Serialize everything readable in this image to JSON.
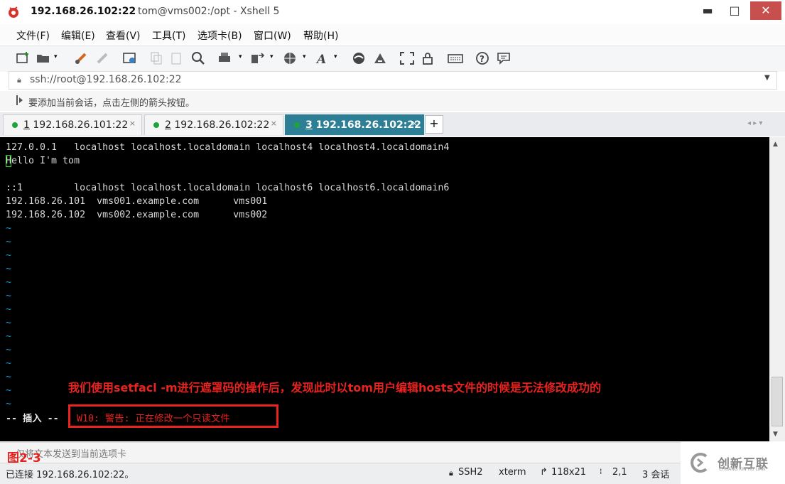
{
  "window": {
    "title_host": "192.168.26.102:22",
    "title_rest": "tom@vms002:/opt - Xshell 5",
    "minimize": "▬",
    "maximize": "□",
    "close": "✕"
  },
  "menu": [
    "文件(F)",
    "编辑(E)",
    "查看(V)",
    "工具(T)",
    "选项卡(B)",
    "窗口(W)",
    "帮助(H)"
  ],
  "toolbar_icons": [
    "new-session-icon",
    "open-folder-icon",
    "connect-icon",
    "disconnect-icon",
    "properties-icon",
    "copy-icon",
    "paste-icon",
    "find-icon",
    "print-icon",
    "transfer-icon",
    "globe-icon",
    "font-icon",
    "xftp-icon",
    "xmanager-icon",
    "fullscreen-icon",
    "lock-icon",
    "keyboard-icon",
    "help-icon",
    "chat-icon"
  ],
  "address": {
    "value": "ssh://root@192.168.26.102:22"
  },
  "info": {
    "text": "要添加当前会话，点击左侧的箭头按钮。"
  },
  "tabs": [
    {
      "num": "1",
      "label": "192.168.26.101:22",
      "close": "×"
    },
    {
      "num": "2",
      "label": "192.168.26.102:22",
      "close": "×"
    },
    {
      "num": "3",
      "label": "192.168.26.102:22",
      "close": "×"
    }
  ],
  "tab_add": "+",
  "tab_nav": "◂ ▸ ▾",
  "terminal": {
    "lines": [
      "127.0.0.1   localhost localhost.localdomain localhost4 localhost4.localdomain4",
      "Hello I'm tom",
      "",
      "::1         localhost localhost.localdomain localhost6 localhost6.localdomain6",
      "192.168.26.101  vms001.example.com      vms001",
      "192.168.26.102  vms002.example.com      vms002"
    ],
    "tilde": "~",
    "tilde_count": 14,
    "mode": "-- 插入 --",
    "warning": "W10: 警告: 正在修改一个只读文件"
  },
  "annotation": "我们使用setfacl -m进行遮罩码的操作后，发现此时以tom用户编辑hosts文件的时候是无法修改成功的",
  "compose": {
    "text": "仅将文本发送到当前选项卡",
    "figure_label": "图2-3"
  },
  "status": {
    "connection": "已连接 192.168.26.102:22。",
    "protocol": "SSH2",
    "term": "xterm",
    "size": "118x21",
    "position": "2,1",
    "sessions": "3 会话"
  },
  "watermark": {
    "cn": "创新互联",
    "en": "CHUANG XIN HU LIAN"
  },
  "colors": {
    "accent_tab": "#2d7f96",
    "annotation": "#e8231f",
    "tilde": "#1a9cd6",
    "close": "#c7504f"
  }
}
